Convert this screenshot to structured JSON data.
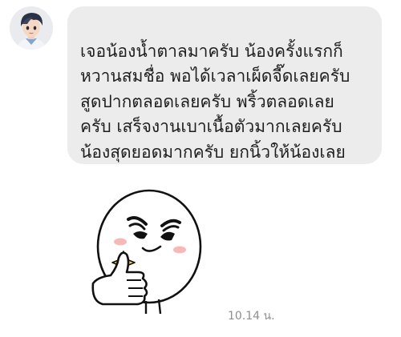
{
  "chat": {
    "message": {
      "text": "เจอน้องน้ำตาลมาครับ น้องครั้งแรกก็\nหวานสมชื่อ พอได้เวลาเผ็ดจี๊ดเลยครับ\nสูดปากตลอดเลยครับ พริ้วตลอดเลย\nครับ เสร็จงานเบาเนื้อตัวมากเลยครับ\nน้องสุดยอดมากครับ ยกนิ้วให้น้องเลย\nครับ"
    },
    "sticker": {
      "description_icon": "thumbs-up-sticker-icon"
    },
    "timestamp": "10.14 น."
  },
  "colors": {
    "bubble_background": "#ececec",
    "message_text": "#1e1e1e",
    "timestamp_text": "#8f8f8f"
  }
}
